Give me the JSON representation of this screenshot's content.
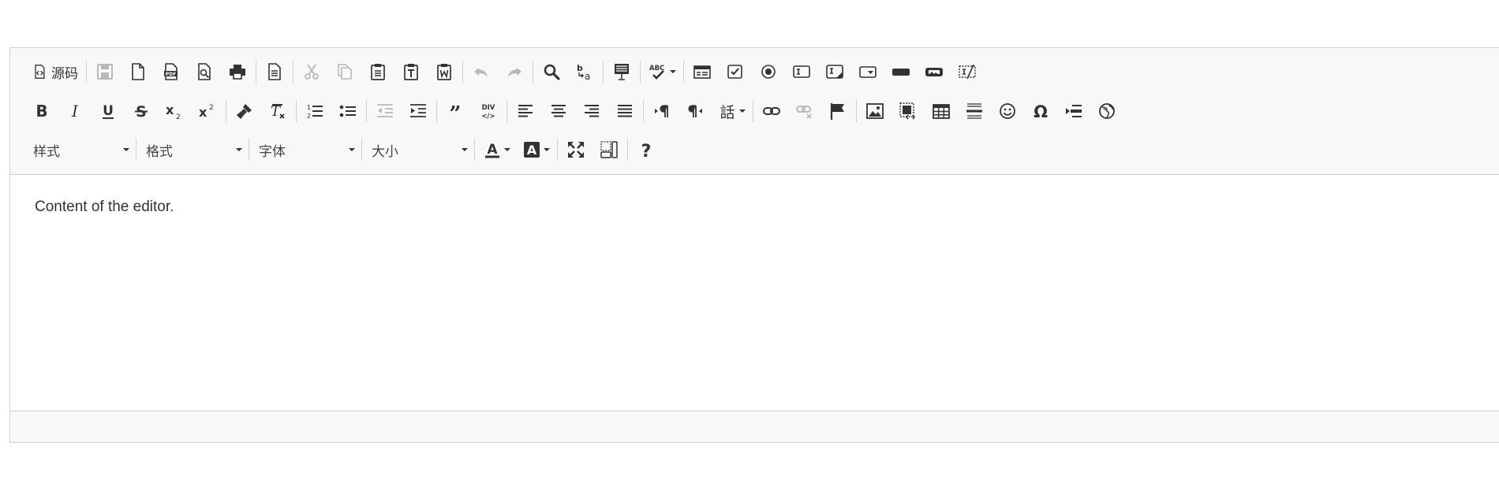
{
  "toolbar": {
    "source_label": "源码",
    "combos": {
      "styles": "样式",
      "format": "格式",
      "font": "字体",
      "size": "大小"
    }
  },
  "content": {
    "text": "Content of the editor."
  },
  "colors": {
    "toolbar_bg": "#f8f8f8",
    "border": "#d1d1d1",
    "icon": "#333333",
    "disabled_icon": "#a0a0a0"
  }
}
